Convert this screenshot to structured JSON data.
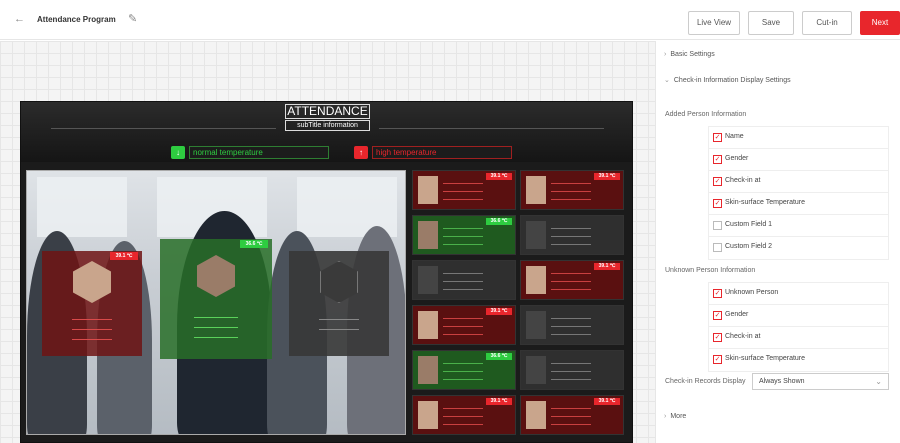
{
  "header": {
    "back_icon": "arrow-left-icon",
    "title": "Attendance Program",
    "edit_icon": "pencil-icon",
    "buttons": {
      "live_view": "Live View",
      "save": "Save",
      "cut_in": "Cut-in",
      "next": "Next"
    }
  },
  "canvas": {
    "title": "ATTENDANCE",
    "subtitle": "subTitle information",
    "normal_label": "normal temperature",
    "high_label": "high temperature",
    "normal_color": "#2ecc40",
    "high_color": "#e8262c",
    "featured": [
      {
        "temp": "39.1 ℃",
        "status": "high"
      },
      {
        "temp": "36.6 ℃",
        "status": "normal"
      },
      {
        "temp": "",
        "status": "unknown"
      }
    ],
    "cards": [
      {
        "temp": "39.1 ℃",
        "status": "high"
      },
      {
        "temp": "39.1 ℃",
        "status": "high"
      },
      {
        "temp": "36.6 ℃",
        "status": "normal"
      },
      {
        "temp": "",
        "status": "unknown"
      },
      {
        "temp": "",
        "status": "unknown"
      },
      {
        "temp": "39.1 ℃",
        "status": "high"
      },
      {
        "temp": "39.1 ℃",
        "status": "high"
      },
      {
        "temp": "",
        "status": "unknown"
      },
      {
        "temp": "36.6 ℃",
        "status": "normal"
      },
      {
        "temp": "",
        "status": "unknown"
      },
      {
        "temp": "39.1 ℃",
        "status": "high"
      },
      {
        "temp": "39.1 ℃",
        "status": "high"
      }
    ]
  },
  "panel": {
    "basic_settings": "Basic Settings",
    "checkin_settings": "Check-in Information Display Settings",
    "added_person_label": "Added Person Information",
    "added_person_items": [
      {
        "label": "Name",
        "checked": true
      },
      {
        "label": "Gender",
        "checked": true
      },
      {
        "label": "Check-in at",
        "checked": true
      },
      {
        "label": "Skin-surface Temperature",
        "checked": true
      },
      {
        "label": "Custom Field 1",
        "checked": false
      },
      {
        "label": "Custom Field 2",
        "checked": false
      }
    ],
    "unknown_person_label": "Unknown Person Information",
    "unknown_person_items": [
      {
        "label": "Unknown Person",
        "checked": true
      },
      {
        "label": "Gender",
        "checked": true
      },
      {
        "label": "Check-in at",
        "checked": true
      },
      {
        "label": "Skin-surface Temperature",
        "checked": true
      }
    ],
    "records_display_label": "Check-in Records Display",
    "records_display_value": "Always Shown",
    "more": "More"
  }
}
